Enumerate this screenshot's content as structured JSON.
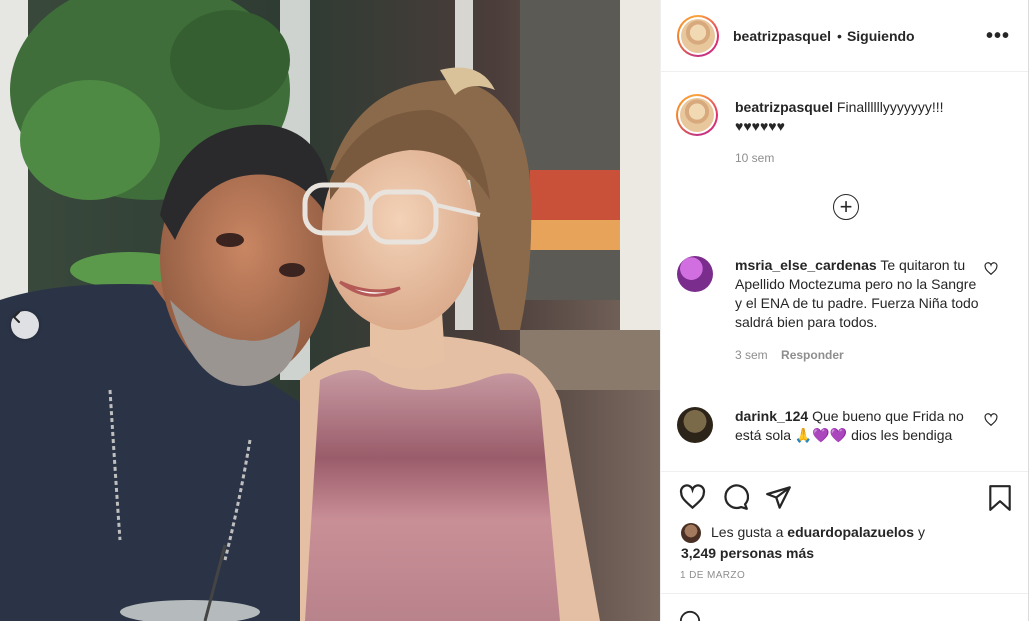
{
  "post": {
    "username": "beatrizpasquel",
    "dot": "•",
    "follow_status": "Siguiendo",
    "more_icon": "more-options-icon",
    "caption": {
      "username": "beatrizpasquel",
      "text": "Finallllllyyyyyyy!!! ♥♥♥♥♥♥",
      "time": "10 sem"
    },
    "load_more_icon": "add-circle-icon",
    "comments": [
      {
        "username": "msria_else_cardenas",
        "text": "Te quitaron tu Apellido Moctezuma pero no la Sangre y el ENA de tu padre. Fuerza Niña todo saldrá bien para todos.",
        "time": "3 sem",
        "reply_label": "Responder"
      },
      {
        "username": "darink_124",
        "text": "Que bueno que Frida no está sola 🙏💜💜 dios les bendiga",
        "time": "",
        "reply_label": ""
      }
    ],
    "likes": {
      "prefix": "Les gusta a",
      "user": "eduardopalazuelos",
      "conj": "y",
      "others": "3,249 personas más"
    },
    "date": "1 DE MARZO"
  },
  "colors": {
    "text": "#262626",
    "secondary": "#8e8e8e",
    "border": "#efefef"
  }
}
